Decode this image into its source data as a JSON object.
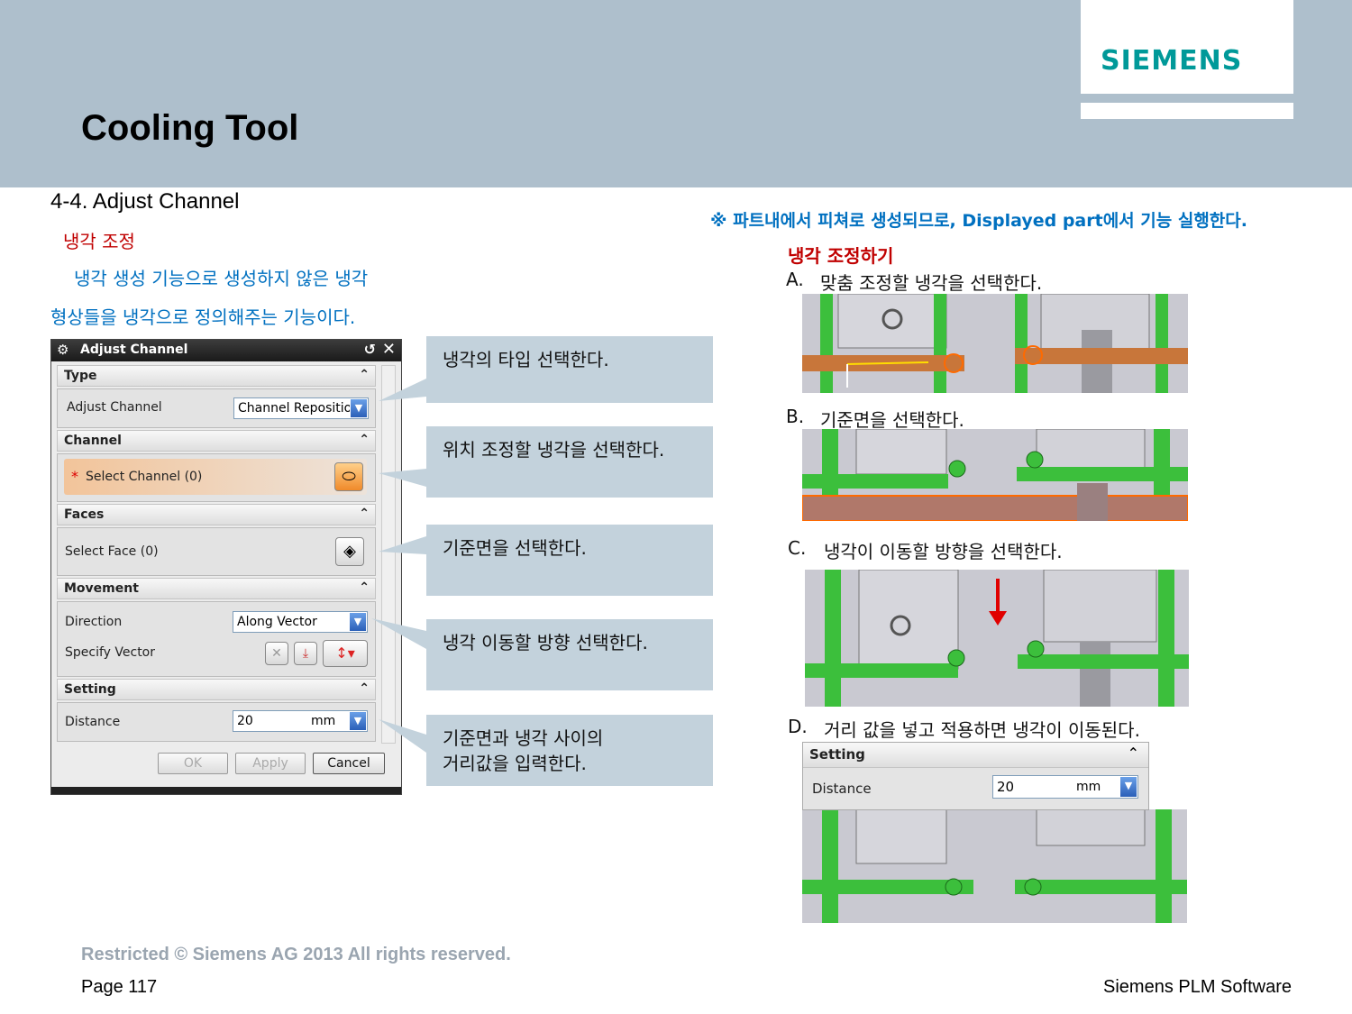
{
  "header": {
    "logo": "SIEMENS",
    "title": "Cooling Tool"
  },
  "section": {
    "heading": "4-4.  Adjust  Channel",
    "subheading": "냉각 조정",
    "desc_line1": "냉각 생성 기능으로 생성하지 않은 냉각",
    "desc_line2": "형상들을 냉각으로 정의해주는 기능이다."
  },
  "note": "※ 파트내에서 피쳐로 생성되므로, Displayed part에서 기능 실행한다.",
  "dialog": {
    "title": "Adjust Channel",
    "type_group": "Type",
    "type_label": "Adjust Channel",
    "type_value": "Channel Repositio",
    "channel_group": "Channel",
    "select_channel": "Select Channel (0)",
    "faces_group": "Faces",
    "select_face": "Select Face (0)",
    "movement_group": "Movement",
    "direction_label": "Direction",
    "direction_value": "Along Vector",
    "specify_vector": "Specify Vector",
    "setting_group": "Setting",
    "distance_label": "Distance",
    "distance_value": "20",
    "distance_unit": "mm",
    "ok": "OK",
    "apply": "Apply",
    "cancel": "Cancel"
  },
  "callouts": [
    "냉각의 타입 선택한다.",
    "위치 조정할 냉각을 선택한다.",
    "기준면을 선택한다.",
    "냉각 이동할 방향 선택한다.",
    "기준면과 냉각 사이의",
    "거리값을 입력한다."
  ],
  "right": {
    "heading": "냉각 조정하기",
    "step_a_letter": "A.",
    "step_a": "맞춤 조정할 냉각을 선택한다.",
    "step_b_letter": "B.",
    "step_b": "기준면을 선택한다.",
    "step_c_letter": "C.",
    "step_c": "냉각이 이동할 방향을 선택한다.",
    "step_d_letter": "D.",
    "step_d": "거리 값을 넣고 적용하면 냉각이 이동된다.",
    "setting_group": "Setting",
    "distance_label": "Distance",
    "distance_value": "20",
    "distance_unit": "mm"
  },
  "footer": {
    "restricted": "Restricted © Siemens AG 2013 All rights reserved.",
    "page": "Page 117",
    "company": "Siemens PLM Software"
  },
  "colors": {
    "header_bg": "#aebfcc",
    "logo": "#009999",
    "accent_blue": "#0070c0",
    "accent_red": "#c00000",
    "callout_bg": "#c3d2dc",
    "channel_green": "#3cbf3c",
    "selected_orange": "#c8763a"
  }
}
